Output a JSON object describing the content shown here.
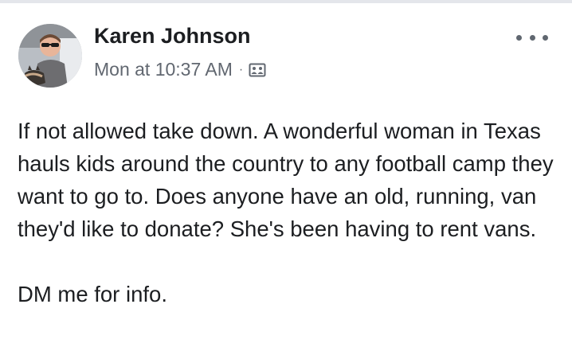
{
  "post": {
    "author": "Karen Johnson",
    "timestamp": "Mon at 10:37 AM",
    "separator": "·",
    "audience_icon": "privacy-group-icon",
    "more_icon": "more-options-icon",
    "paragraphs": [
      "If not allowed take down.  A wonderful woman in Texas hauls kids around the country to any football camp they want to go to.  Does anyone have an old, running, van they'd like to donate? She's been having to rent vans.",
      "DM me for info."
    ]
  },
  "colors": {
    "text": "#1c1e21",
    "meta": "#616770",
    "divider": "#e4e6eb"
  }
}
